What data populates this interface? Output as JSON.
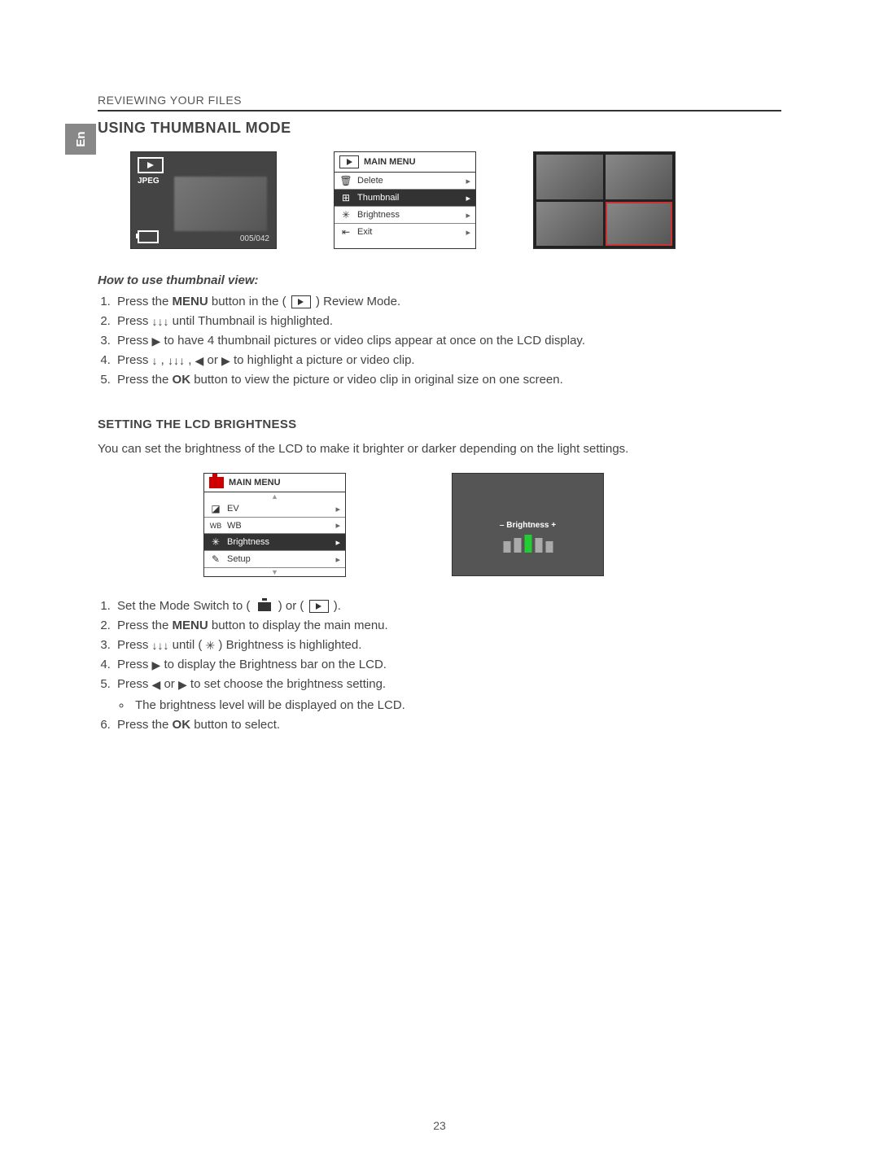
{
  "lang_tab": "En",
  "section_header": "REVIEWING YOUR FILES",
  "title_thumbnail": "USING THUMBNAIL MODE",
  "lcd_preview": {
    "format": "JPEG",
    "counter": "005/042"
  },
  "review_menu": {
    "title": "MAIN MENU",
    "items": [
      {
        "icon": "🗑",
        "label": "Delete",
        "highlight": false
      },
      {
        "icon": "⊞",
        "label": "Thumbnail",
        "highlight": true
      },
      {
        "icon": "✳",
        "label": "Brightness",
        "highlight": false
      },
      {
        "icon": "⇤",
        "label": "Exit",
        "highlight": false
      }
    ]
  },
  "howto_heading": "How to use thumbnail view:",
  "thumbnail_steps": {
    "s1a": "Press the ",
    "s1b": "MENU",
    "s1c": " button in the ( ",
    "s1d": " ) Review Mode.",
    "s2a": "Press  ",
    "s2b": "  until Thumbnail is highlighted.",
    "s3a": "Press   ",
    "s3b": "  to have 4 thumbnail pictures or video clips appear at once on the LCD display.",
    "s4a": "Press   ",
    "s4b": "  ,  ",
    "s4c": "  ,   ",
    "s4d": "   or   ",
    "s4e": "   to highlight a picture or video clip.",
    "s5a": "Press the ",
    "s5b": "OK",
    "s5c": " button to view the picture or video clip in original size on one screen."
  },
  "brightness_title": "SETTING THE LCD BRIGHTNESS",
  "brightness_intro": "You can set the brightness of the LCD to make it brighter or darker depending on the light settings.",
  "capture_menu": {
    "title": "MAIN MENU",
    "items": [
      {
        "icon": "◪",
        "label": "EV",
        "highlight": false
      },
      {
        "icon": "WB",
        "label": "WB",
        "highlight": false
      },
      {
        "icon": "✳",
        "label": "Brightness",
        "highlight": true
      },
      {
        "icon": "✎",
        "label": "Setup",
        "highlight": false
      }
    ]
  },
  "brightness_overlay": {
    "label": "–  Brightness  +",
    "bars": [
      14,
      18,
      22,
      18,
      14
    ],
    "active_index": 2
  },
  "brightness_steps": {
    "s1a": "Set the Mode Switch to ( ",
    "s1b": " ) or ( ",
    "s1c": " ).",
    "s2a": "Press the ",
    "s2b": "MENU",
    "s2c": " button to display the main menu.",
    "s3a": "Press  ",
    "s3b": "  until ( ",
    "s3c": " ) Brightness is highlighted.",
    "s4a": "Press  ",
    "s4b": "  to display the Brightness bar on the LCD.",
    "s5a": "Press  ",
    "s5b": "  or  ",
    "s5c": "  to set choose the brightness setting.",
    "s5sub": "The brightness level will be displayed on the LCD.",
    "s6a": "Press the ",
    "s6b": "OK",
    "s6c": " button to select."
  },
  "page_number": "23",
  "glyphs": {
    "down3": "↓↓↓",
    "down1": "↓",
    "right": "▶",
    "left": "◀",
    "sun": "✳"
  }
}
